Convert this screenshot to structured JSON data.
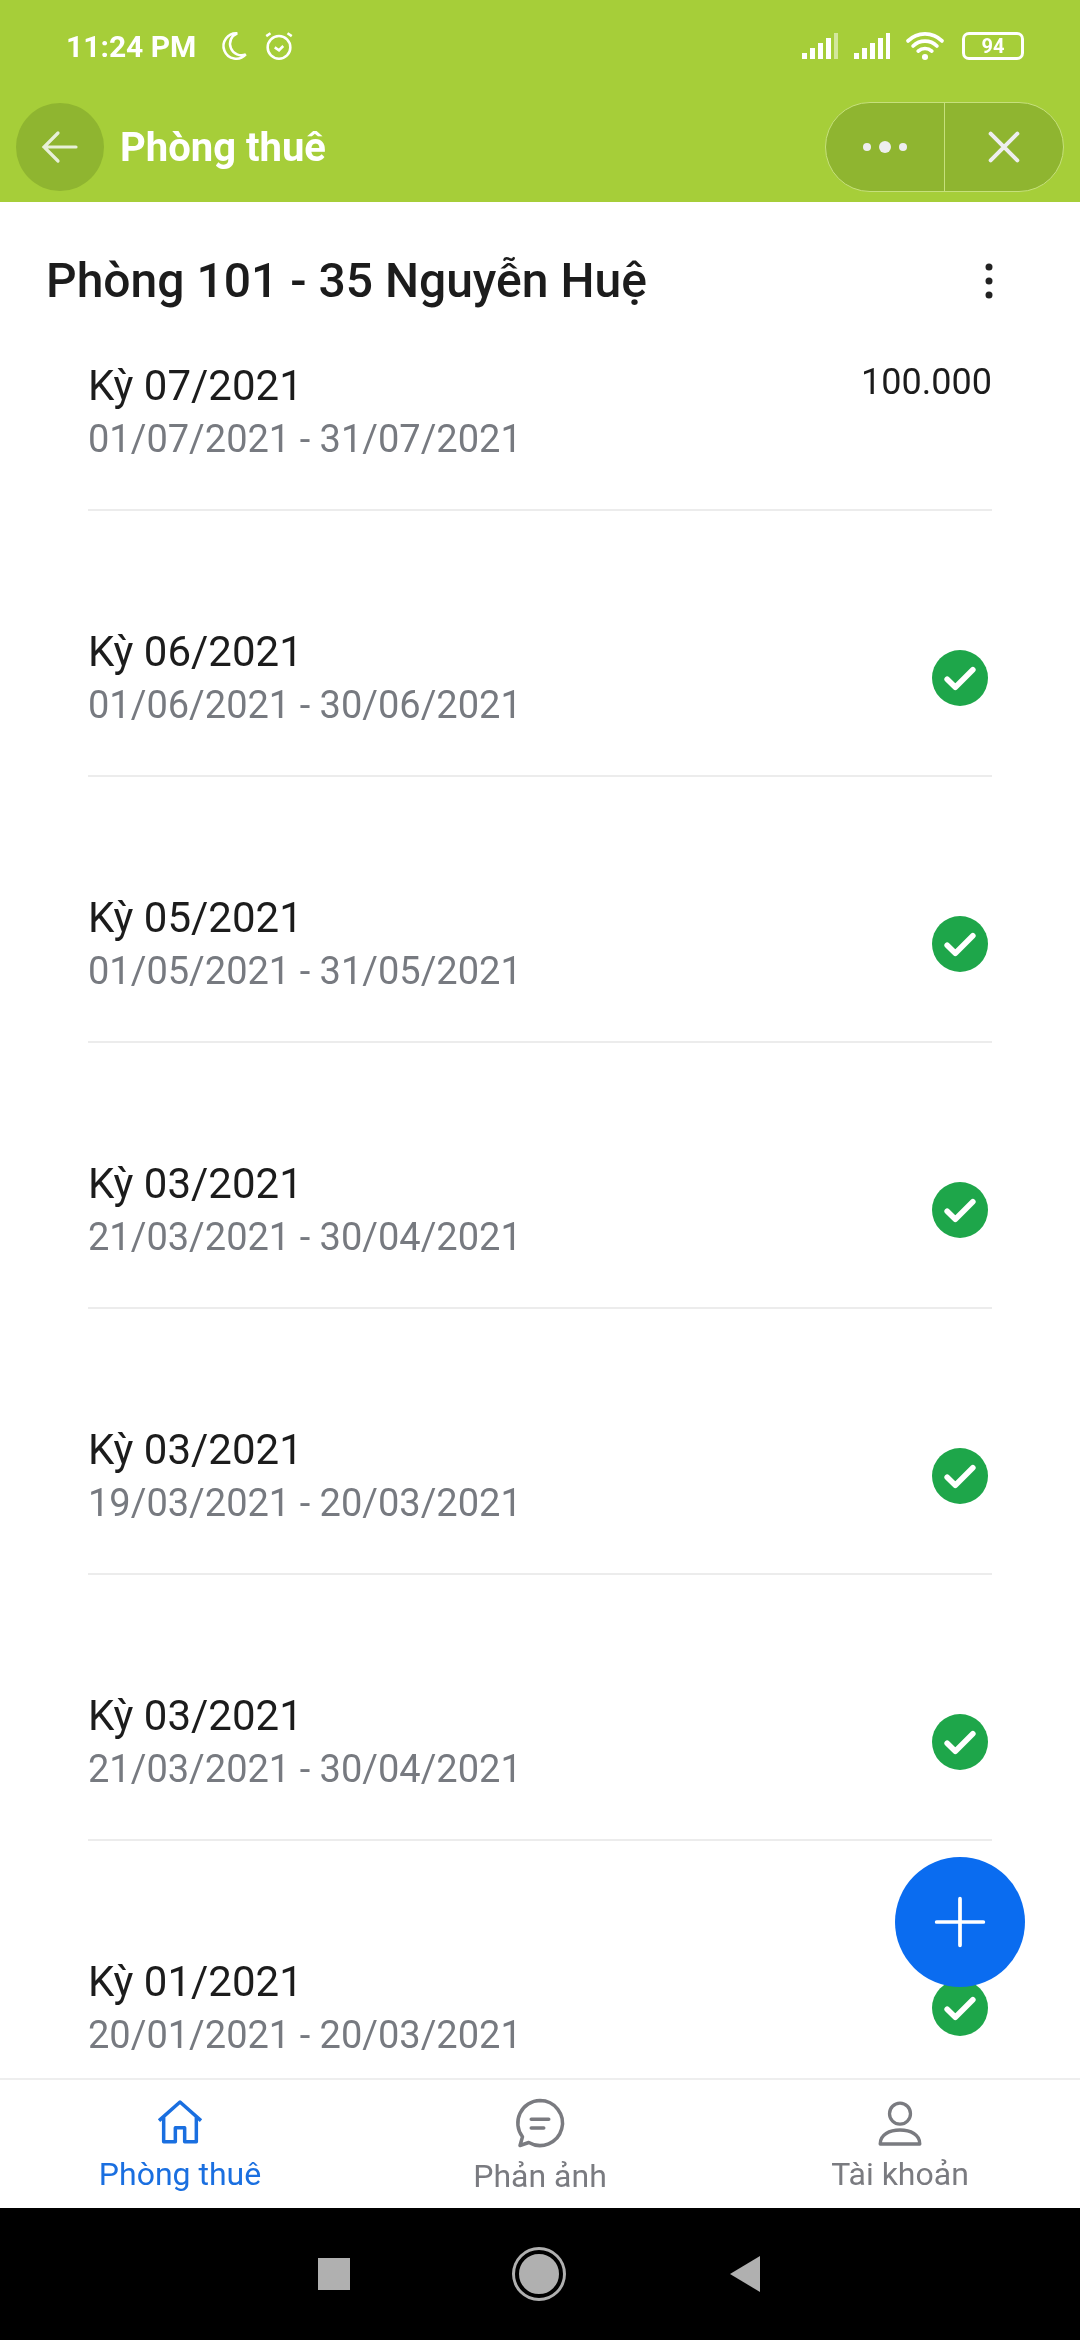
{
  "status_bar": {
    "time": "11:24 PM",
    "battery": "94"
  },
  "app_bar": {
    "title": "Phòng thuê"
  },
  "section": {
    "title": "Phòng 101 - 35 Nguyễn Huệ"
  },
  "periods": [
    {
      "title": "Kỳ 07/2021",
      "dates": "01/07/2021 - 31/07/2021",
      "paid": false,
      "amount": "100.000"
    },
    {
      "title": "Kỳ 06/2021",
      "dates": "01/06/2021 - 30/06/2021",
      "paid": true
    },
    {
      "title": "Kỳ 05/2021",
      "dates": "01/05/2021 - 31/05/2021",
      "paid": true
    },
    {
      "title": "Kỳ 03/2021",
      "dates": "21/03/2021 - 30/04/2021",
      "paid": true
    },
    {
      "title": "Kỳ 03/2021",
      "dates": "19/03/2021 - 20/03/2021",
      "paid": true
    },
    {
      "title": "Kỳ 03/2021",
      "dates": "21/03/2021 - 30/04/2021",
      "paid": true
    },
    {
      "title": "Kỳ 01/2021",
      "dates": "20/01/2021 - 20/03/2021",
      "paid": true
    }
  ],
  "bottom_nav": [
    {
      "label": "Phòng thuê",
      "kind": "home",
      "selected": true
    },
    {
      "label": "Phản ảnh",
      "kind": "chat",
      "selected": false
    },
    {
      "label": "Tài khoản",
      "kind": "account",
      "selected": false
    }
  ]
}
